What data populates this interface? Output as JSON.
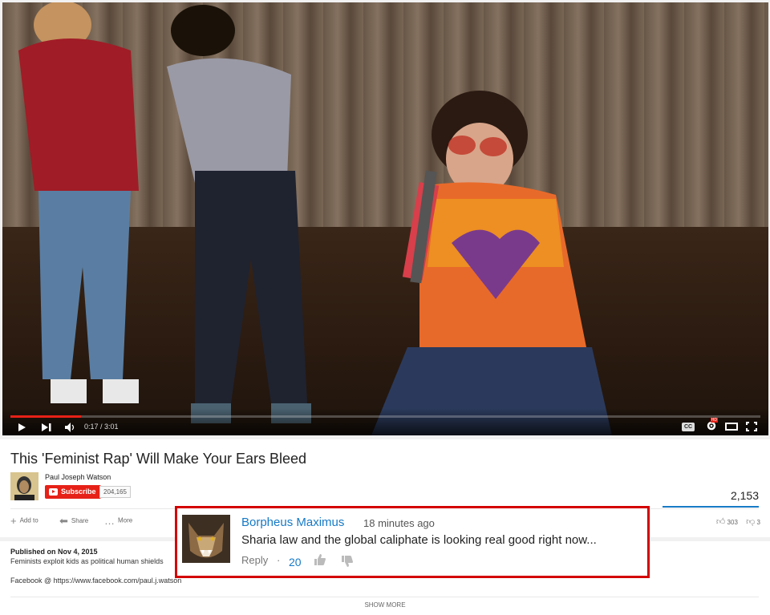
{
  "player": {
    "time": "0:17 / 3:01",
    "progress_fraction": 0.094,
    "icons": [
      "play-icon",
      "next-icon",
      "volume-icon",
      "cc-icon",
      "settings-icon",
      "theater-icon",
      "fullscreen-icon"
    ],
    "cc_label": "CC",
    "hd_badge": "HD"
  },
  "video": {
    "title": "This 'Feminist Rap' Will Make Your Ears Bleed",
    "channel": "Paul Joseph Watson",
    "subscribe_label": "Subscribe",
    "subscriber_count": "204,165",
    "views": "2,153",
    "actions": [
      {
        "label": "Add to",
        "icon": "plus-icon"
      },
      {
        "label": "Share",
        "icon": "share-icon"
      },
      {
        "label": "More",
        "icon": "more-icon"
      }
    ],
    "likes": "303",
    "dislikes": "3"
  },
  "description": {
    "published": "Published on Nov 4, 2015",
    "line1": "Feminists exploit kids as political human shields",
    "line2": "Facebook @ https://www.facebook.com/paul.j.watson",
    "show_more": "SHOW MORE"
  },
  "comment": {
    "author": "Borpheus Maximus",
    "time": "18 minutes ago",
    "text": "Sharia law and the global caliphate is looking real good right now...",
    "reply_label": "Reply",
    "separator": "·",
    "likes": "20"
  },
  "colors": {
    "accent_red": "#e62117",
    "link_blue": "#167ac6",
    "highlight_border": "#d40000"
  }
}
